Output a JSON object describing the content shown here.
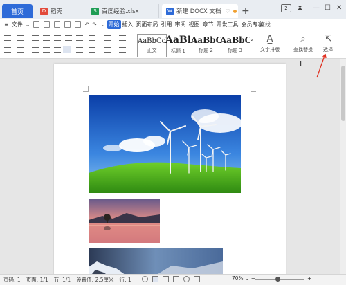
{
  "tabs": {
    "home": "首页",
    "docer": "稻壳",
    "sheet": "百度经验.xlsx",
    "doc": "新建 DOCX 文档"
  },
  "window": {
    "badge": "2",
    "new_tab": "+"
  },
  "menu": {
    "file": "文件",
    "items": [
      "开始",
      "插入",
      "页面布局",
      "引用",
      "审阅",
      "视图",
      "章节",
      "开发工具",
      "会员专享"
    ],
    "search": "查找"
  },
  "ribbon": {
    "styles": [
      {
        "sample": "AaBbCcDd",
        "label": "正文"
      },
      {
        "sample": "AaBl",
        "label": "标题 1"
      },
      {
        "sample": "AaBbC",
        "label": "标题 2"
      },
      {
        "sample": "AaBbC",
        "label": "标题 3"
      }
    ],
    "text_layout": "文字排版",
    "find_replace": "查找替换",
    "select": "选择"
  },
  "status": {
    "page_num": "页码: 1",
    "page_total": "页面: 1/1",
    "section": "节: 1/1",
    "setting": "设置值: 2.5厘米",
    "row": "行: 1",
    "zoom": "70%"
  },
  "colors": {
    "accent": "#2e6bd8",
    "arrow": "#e03020"
  }
}
